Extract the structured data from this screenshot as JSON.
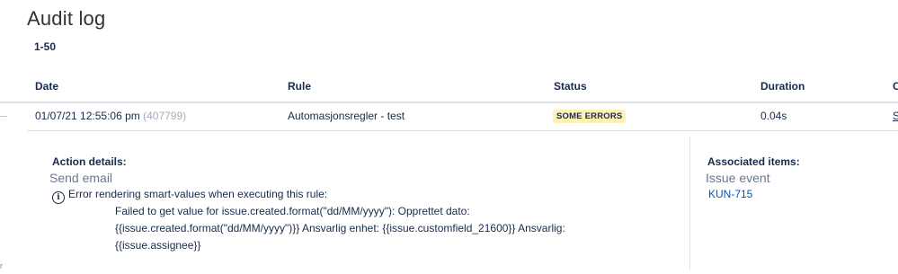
{
  "page": {
    "title": "Audit log",
    "range": "1-50"
  },
  "table": {
    "columns": [
      "Date",
      "Rule",
      "Status",
      "Duration",
      "C"
    ],
    "rows": [
      {
        "date": "01/07/21 12:55:06 pm",
        "id": "(407799)",
        "rule": "Automasjonsregler - test",
        "status": "SOME ERRORS",
        "duration": "0.04s",
        "extra": "S"
      }
    ]
  },
  "details": {
    "action_label": "Action details:",
    "action_name": "Send email",
    "error_icon": "info-icon",
    "error_summary": "Error rendering smart-values when executing this rule:",
    "error_lines": [
      "Failed to get value for issue.created.format(\"dd/MM/yyyy\"): Opprettet dato:",
      "{{issue.created.format(\"dd/MM/yyyy\")}} Ansvarlig enhet: {{issue.customfield_21600}} Ansvarlig:",
      "{{issue.assignee}}"
    ],
    "associated_label": "Associated items:",
    "associated_type": "Issue event",
    "associated_link": "KUN-715"
  },
  "colors": {
    "status_background": "#fff0b3",
    "link": "#0052cc",
    "muted": "#a5adba"
  }
}
